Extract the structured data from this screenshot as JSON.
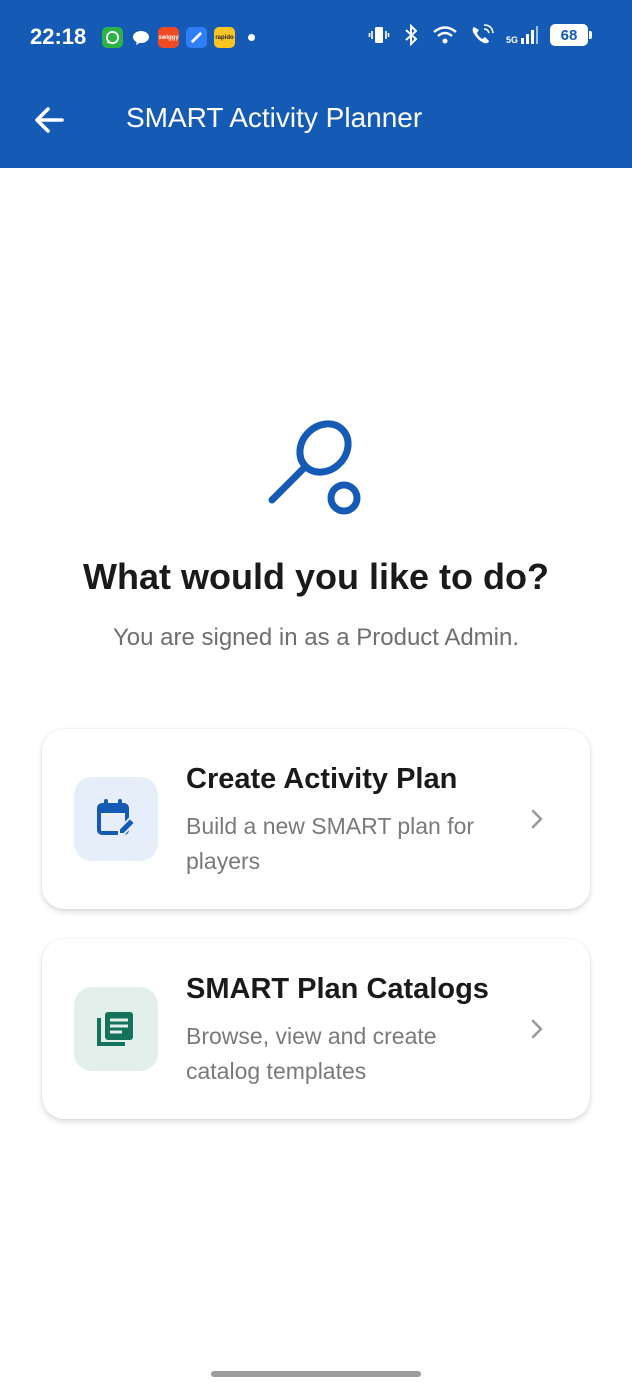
{
  "status_bar": {
    "time": "22:18",
    "notification_apps": [
      "whatsapp-icon",
      "messages-icon",
      "swiggy-icon",
      "app-icon",
      "rapido-icon"
    ],
    "swiggy_label": "swiggy",
    "rapido_label": "rapido",
    "network_label": "5G",
    "battery": "68"
  },
  "header": {
    "back_icon": "arrow-left-icon",
    "title": "SMART Activity Planner",
    "background_color": "#155bb5"
  },
  "hero": {
    "icon": "racket-icon",
    "headline": "What would you like to do?",
    "subline": "You are signed in as a Product Admin."
  },
  "options": [
    {
      "icon": "calendar-edit-icon",
      "title": "Create Activity Plan",
      "description": "Build a new SMART plan for players",
      "accent_color": "#155bb5"
    },
    {
      "icon": "catalog-list-icon",
      "title": "SMART Plan Catalogs",
      "description": "Browse, view and create catalog templates",
      "accent_color": "#14735a"
    }
  ]
}
